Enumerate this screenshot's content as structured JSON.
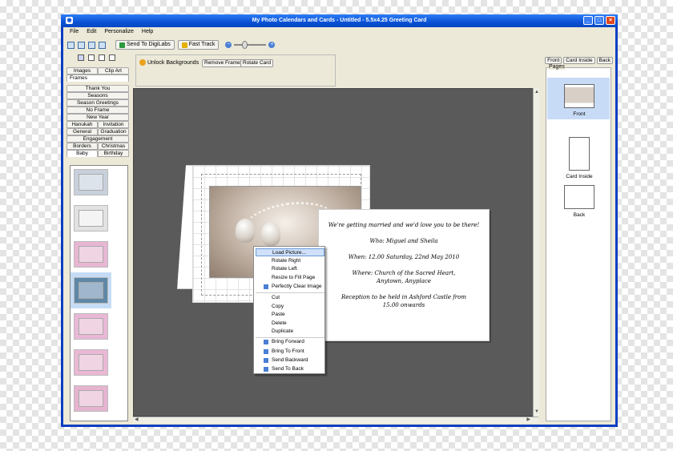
{
  "window": {
    "title": "My Photo Calendars and Cards - Untitled - 5.5x4.25 Greeting Card"
  },
  "menu": [
    "File",
    "Edit",
    "Personalize",
    "Help"
  ],
  "toolbar": {
    "send_label": "Send To DigiLabs",
    "fast_track_label": "Fast Track",
    "zoom_percent": 30
  },
  "left": {
    "top_tabs": [
      "Images",
      "Clip Art",
      "Frames"
    ],
    "categories": {
      "thank_you": "Thank You",
      "seasons": "Seasons",
      "season_greetings": "Season Greetings",
      "no_frame": "No Frame",
      "new_year": "New Year",
      "hanukah": "Hanukah",
      "invitation": "Invitation",
      "general": "General",
      "graduation": "Graduation",
      "engagement": "Engagement",
      "borders": "Borders",
      "christmas": "Christmas",
      "baby": "Baby",
      "birthday": "Birthday"
    },
    "thumb_colors": [
      "#c8d0dc",
      "#e2e2e2",
      "#e7b6d2",
      "#5f87a6",
      "#e8b8d6",
      "#eab8d4",
      "#e6b4d0"
    ]
  },
  "options": {
    "unlock_label": "Unlock Backgrounds",
    "remove_frame": "Remove Frame",
    "rotate_card": "Rotate Card"
  },
  "card": {
    "lines": [
      "We're getting married and we'd love you to be there!",
      "Who: Miguel and Sheila",
      "When: 12.00 Saturday, 22nd May 2010",
      "Where: Church of the Sacred Heart, Anytown, Anyplace",
      "Reception to be held in Ashford Castle from 15.00 onwards"
    ]
  },
  "context_menu": [
    "Load Picture...",
    "Rotate Right",
    "Rotate Left",
    "Resize to Fill Page",
    "Perfectly Clear Image",
    "Cut",
    "Copy",
    "Paste",
    "Delete",
    "Duplicate",
    "Bring Forward",
    "Bring To Front",
    "Send Backward",
    "Send To Back"
  ],
  "right": {
    "buttons": {
      "front": "Front",
      "inside": "Card Inside",
      "back": "Back"
    },
    "pages_legend": "Pages",
    "pages": [
      "Front",
      "Card Inside",
      "Back"
    ]
  }
}
